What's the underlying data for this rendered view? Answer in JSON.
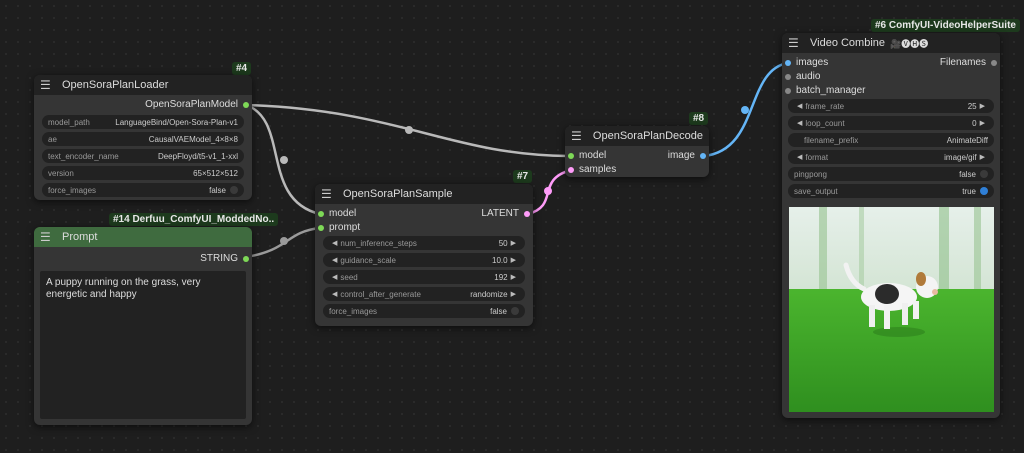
{
  "nodes": {
    "loader": {
      "badge": "#4",
      "title": "OpenSoraPlanLoader",
      "output": "OpenSoraPlanModel",
      "widgets": [
        {
          "label": "model_path",
          "value": "LanguageBind/Open-Sora-Plan-v1"
        },
        {
          "label": "ae",
          "value": "CausalVAEModel_4×8×8"
        },
        {
          "label": "text_encoder_name",
          "value": "DeepFloyd/t5-v1_1-xxl"
        },
        {
          "label": "version",
          "value": "65×512×512"
        },
        {
          "label": "force_images",
          "value": "false"
        }
      ]
    },
    "prompt": {
      "badge": "#14 Derfuu_ComfyUI_ModdedNo..",
      "title": "Prompt",
      "output": "STRING",
      "text": "A puppy running on the grass, very energetic and happy"
    },
    "sample": {
      "badge": "#7",
      "title": "OpenSoraPlanSample",
      "inputs": [
        "model",
        "prompt"
      ],
      "output": "LATENT",
      "widgets": [
        {
          "label": "num_inference_steps",
          "value": "50"
        },
        {
          "label": "guidance_scale",
          "value": "10.0"
        },
        {
          "label": "seed",
          "value": "192"
        },
        {
          "label": "control_after_generate",
          "value": "randomize"
        },
        {
          "label": "force_images",
          "value": "false"
        }
      ]
    },
    "decode": {
      "badge": "#8",
      "title": "OpenSoraPlanDecode",
      "inputs": [
        "model",
        "samples"
      ],
      "output": "image"
    },
    "video": {
      "badge": "#6 ComfyUI-VideoHelperSuite",
      "title": "Video Combine",
      "title_icons": "🎥🅥🅗🅢",
      "inputs": [
        "images",
        "audio",
        "batch_manager"
      ],
      "output": "Filenames",
      "widgets": [
        {
          "label": "frame_rate",
          "value": "25"
        },
        {
          "label": "loop_count",
          "value": "0"
        },
        {
          "label": "filename_prefix",
          "value": "AnimateDiff"
        },
        {
          "label": "format",
          "value": "image/gif"
        },
        {
          "label": "pingpong",
          "value": "false"
        },
        {
          "label": "save_output",
          "value": "true"
        }
      ],
      "preview_alt": "puppy running on grass"
    }
  },
  "colors": {
    "model_link": "#b9b9b9",
    "string_link": "#9a9a9a",
    "latent_link": "#ff9cf9",
    "image_link": "#64b5f6",
    "slot_green": "#7ed957",
    "prompt_header": "#3f6b3f"
  }
}
